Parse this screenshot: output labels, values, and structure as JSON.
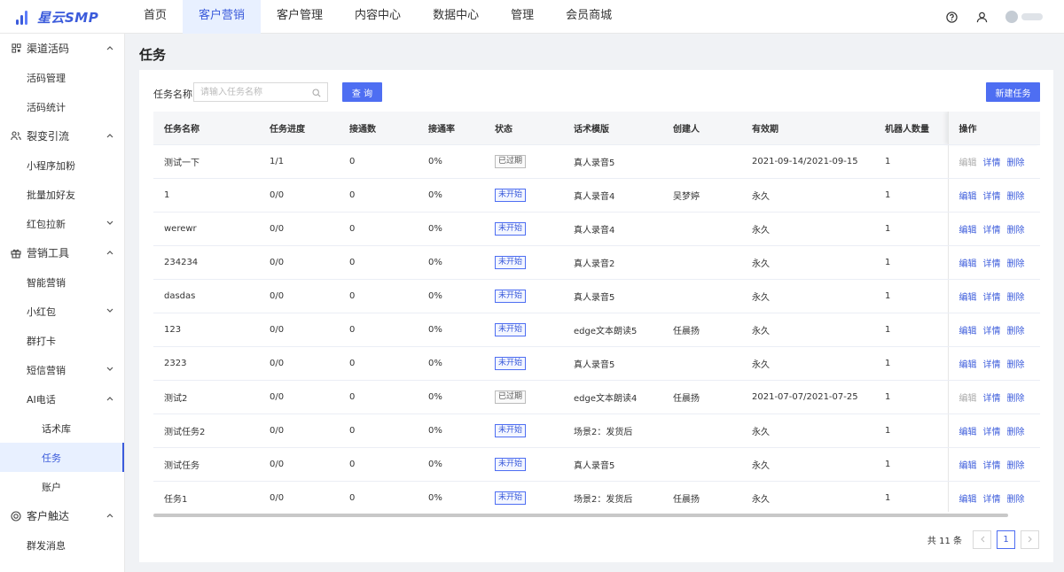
{
  "app": {
    "logo_text": "星云SMP"
  },
  "topnav": [
    {
      "label": "首页",
      "active": false
    },
    {
      "label": "客户营销",
      "active": true
    },
    {
      "label": "客户管理",
      "active": false
    },
    {
      "label": "内容中心",
      "active": false
    },
    {
      "label": "数据中心",
      "active": false
    },
    {
      "label": "管理",
      "active": false
    },
    {
      "label": "会员商城",
      "active": false
    }
  ],
  "sidebar": {
    "g1": "渠道活码",
    "g1_i1": "活码管理",
    "g1_i2": "活码统计",
    "g2": "裂变引流",
    "g2_i1": "小程序加粉",
    "g2_i2": "批量加好友",
    "g2_i3": "红包拉新",
    "g3": "营销工具",
    "g3_i1": "智能营销",
    "g3_i2": "小红包",
    "g3_i3": "群打卡",
    "g3_i4": "短信营销",
    "g3_i5": "AI电话",
    "g3_s1": "话术库",
    "g3_s2": "任务",
    "g3_s3": "账户",
    "g4": "客户触达",
    "g4_i1": "群发消息"
  },
  "page": {
    "title": "任务"
  },
  "search": {
    "label": "任务名称:",
    "placeholder": "请输入任务名称",
    "query_label": "查 询",
    "new_label": "新建任务"
  },
  "table": {
    "headers": [
      "任务名称",
      "任务进度",
      "接通数",
      "接通率",
      "状态",
      "话术模版",
      "创建人",
      "有效期",
      "机器人数量",
      "操作"
    ],
    "actions": {
      "edit": "编辑",
      "detail": "详情",
      "delete": "删除"
    },
    "rows": [
      {
        "name": "测试一下",
        "progress": "1/1",
        "connected": "0",
        "rate": "0%",
        "status": "已过期",
        "template": "真人录音5",
        "creator": "",
        "validity": "2021-09-14/2021-09-15",
        "robots": "1"
      },
      {
        "name": "1",
        "progress": "0/0",
        "connected": "0",
        "rate": "0%",
        "status": "未开始",
        "template": "真人录音4",
        "creator": "吴梦婷",
        "validity": "永久",
        "robots": "1"
      },
      {
        "name": "werewr",
        "progress": "0/0",
        "connected": "0",
        "rate": "0%",
        "status": "未开始",
        "template": "真人录音4",
        "creator": "",
        "validity": "永久",
        "robots": "1"
      },
      {
        "name": "234234",
        "progress": "0/0",
        "connected": "0",
        "rate": "0%",
        "status": "未开始",
        "template": "真人录音2",
        "creator": "",
        "validity": "永久",
        "robots": "1"
      },
      {
        "name": "dasdas",
        "progress": "0/0",
        "connected": "0",
        "rate": "0%",
        "status": "未开始",
        "template": "真人录音5",
        "creator": "",
        "validity": "永久",
        "robots": "1"
      },
      {
        "name": "123",
        "progress": "0/0",
        "connected": "0",
        "rate": "0%",
        "status": "未开始",
        "template": "edge文本朗读5",
        "creator": "任晨扬",
        "validity": "永久",
        "robots": "1"
      },
      {
        "name": "2323",
        "progress": "0/0",
        "connected": "0",
        "rate": "0%",
        "status": "未开始",
        "template": "真人录音5",
        "creator": "",
        "validity": "永久",
        "robots": "1"
      },
      {
        "name": "测试2",
        "progress": "0/0",
        "connected": "0",
        "rate": "0%",
        "status": "已过期",
        "template": "edge文本朗读4",
        "creator": "任晨扬",
        "validity": "2021-07-07/2021-07-25",
        "robots": "1"
      },
      {
        "name": "测试任务2",
        "progress": "0/0",
        "connected": "0",
        "rate": "0%",
        "status": "未开始",
        "template": "场景2：发货后",
        "creator": "",
        "validity": "永久",
        "robots": "1"
      },
      {
        "name": "测试任务",
        "progress": "0/0",
        "connected": "0",
        "rate": "0%",
        "status": "未开始",
        "template": "真人录音5",
        "creator": "",
        "validity": "永久",
        "robots": "1"
      },
      {
        "name": "任务1",
        "progress": "0/0",
        "connected": "0",
        "rate": "0%",
        "status": "未开始",
        "template": "场景2：发货后",
        "creator": "任晨扬",
        "validity": "永久",
        "robots": "1"
      }
    ]
  },
  "pagination": {
    "total_text": "共 11 条",
    "current_page": "1",
    "prev": "‹",
    "next": "›"
  },
  "colors": {
    "primary": "#4e6ef2",
    "accent_text": "#3b5bdb",
    "active_bg": "#e8f0ff"
  }
}
